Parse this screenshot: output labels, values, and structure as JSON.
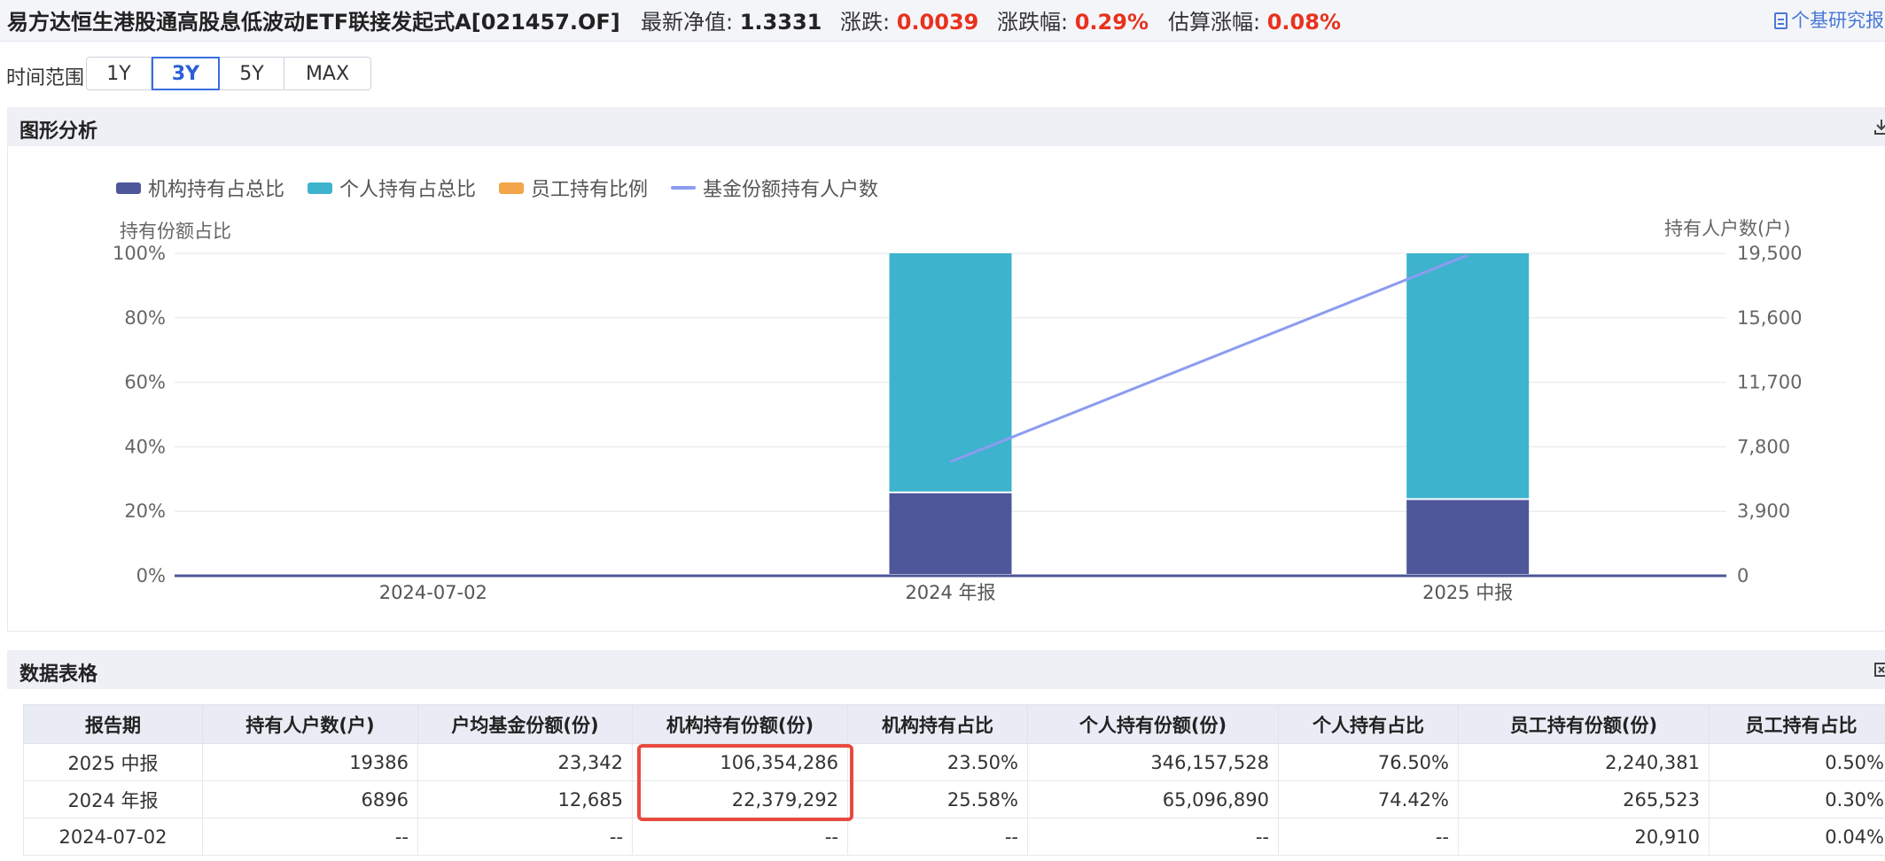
{
  "header": {
    "fund_name": "易方达恒生港股通高股息低波动ETF联接发起式A[021457.OF]",
    "nav_label": "最新净值:",
    "nav_value": "1.3331",
    "change_label": "涨跌:",
    "change_value": "0.0039",
    "change_pct_label": "涨跌幅:",
    "change_pct_value": "0.29%",
    "est_label": "估算涨幅:",
    "est_value": "0.08%",
    "report_link": "个基研究报",
    "colors": {
      "up": "#e8321e",
      "link": "#4a78d6"
    }
  },
  "time_range": {
    "label": "时间范围",
    "options": [
      "1Y",
      "3Y",
      "5Y",
      "MAX"
    ],
    "selected": "3Y"
  },
  "chart_panel": {
    "title": "图形分析",
    "download_icon": "download-icon"
  },
  "chart_data": {
    "type": "bar",
    "stacked": true,
    "categories": [
      "2024-07-02",
      "2024 年报",
      "2025 中报"
    ],
    "legend_position": "top-left",
    "series": [
      {
        "name": "机构持有占总比",
        "type": "bar",
        "axis": "left",
        "color": "#4e5799",
        "values": [
          null,
          25.58,
          23.5
        ]
      },
      {
        "name": "个人持有占总比",
        "type": "bar",
        "axis": "left",
        "color": "#3eb3cd",
        "values": [
          null,
          74.42,
          76.5
        ]
      },
      {
        "name": "员工持有比例",
        "type": "bar",
        "axis": "left",
        "color": "#f2a54a",
        "values": [
          null,
          0.3,
          0.5
        ]
      },
      {
        "name": "基金份额持有人户数",
        "type": "line",
        "axis": "right",
        "color": "#8b9cf0",
        "values": [
          null,
          6896,
          19386
        ]
      }
    ],
    "ylabel": "持有份额占比",
    "y2label": "持有人户数(户)",
    "ylim": [
      0,
      100
    ],
    "y2lim": [
      0,
      19500
    ],
    "yticks": [
      "0%",
      "20%",
      "40%",
      "60%",
      "80%",
      "100%"
    ],
    "y2ticks": [
      "0",
      "3,900",
      "7,800",
      "11,700",
      "15,600",
      "19,500"
    ],
    "grid": true
  },
  "table_panel": {
    "title": "数据表格",
    "tool_icon": "export-icon"
  },
  "table": {
    "columns": [
      "报告期",
      "持有人户数(户)",
      "户均基金份额(份)",
      "机构持有份额(份)",
      "机构持有占比",
      "个人持有份额(份)",
      "个人持有占比",
      "员工持有份额(份)",
      "员工持有占比"
    ],
    "rows": [
      [
        "2025 中报",
        "19386",
        "23,342",
        "106,354,286",
        "23.50%",
        "346,157,528",
        "76.50%",
        "2,240,381",
        "0.50%"
      ],
      [
        "2024 年报",
        "6896",
        "12,685",
        "22,379,292",
        "25.58%",
        "65,096,890",
        "74.42%",
        "265,523",
        "0.30%"
      ],
      [
        "2024-07-02",
        "--",
        "--",
        "--",
        "--",
        "--",
        "--",
        "20,910",
        "0.04%"
      ]
    ],
    "highlight_color": "#e84a3f"
  }
}
